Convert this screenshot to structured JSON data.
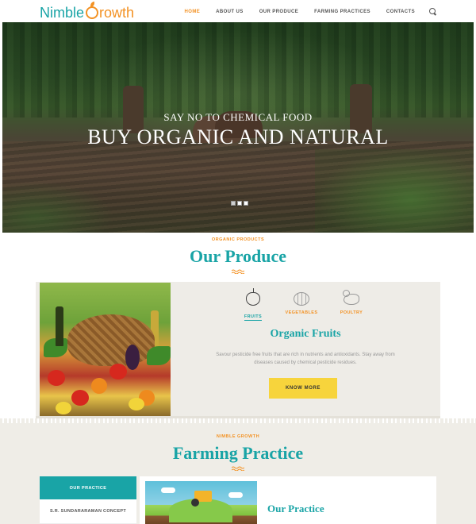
{
  "header": {
    "logo_text_a": "Nimble",
    "logo_text_b": "rowth",
    "nav": [
      {
        "label": "HOME",
        "active": true
      },
      {
        "label": "ABOUT US",
        "active": false
      },
      {
        "label": "OUR PRODUCE",
        "active": false
      },
      {
        "label": "FARMING PRACTICES",
        "active": false
      },
      {
        "label": "CONTACTS",
        "active": false
      }
    ],
    "search_icon": "search-icon"
  },
  "hero": {
    "subtitle": "Say no to chemical food",
    "title": "Buy organic and natural",
    "slides_total": 3,
    "active_slide": 2
  },
  "produce": {
    "kicker": "ORGANIC PRODUCTS",
    "title": "Our Produce",
    "tabs": [
      {
        "label": "FRUITS",
        "icon": "apple-icon",
        "active": true
      },
      {
        "label": "VEGETABLES",
        "icon": "pumpkin-icon",
        "active": false
      },
      {
        "label": "POULTRY",
        "icon": "hen-icon",
        "active": false
      }
    ],
    "heading": "Organic Fruits",
    "description": "Savour pesticide free fruits that are rich in nutrients and antioxidants. Stay away from diseases caused by chemical pesticide residues.",
    "button_label": "KNOW MORE"
  },
  "farming": {
    "kicker": "NIMBLE GROWTH",
    "title": "Farming Practice",
    "menu": [
      {
        "label": "OUR PRACTICE",
        "active": true
      },
      {
        "label": "S.R. SUNDARARAMAN CONCEPT",
        "active": false
      }
    ],
    "panel_title": "Our Practice"
  },
  "colors": {
    "brand_teal": "#19a4a6",
    "brand_orange": "#f39224",
    "button_yellow": "#f7d43c"
  }
}
